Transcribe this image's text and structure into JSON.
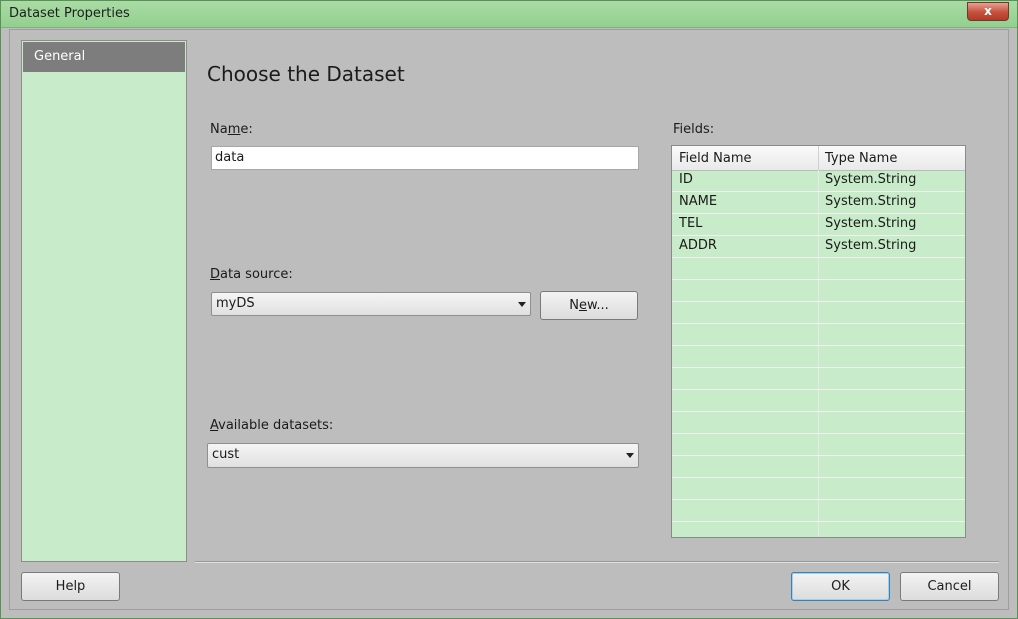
{
  "window": {
    "title": "Dataset Properties",
    "close_label": "x"
  },
  "nav": {
    "items": [
      {
        "label": "General"
      }
    ]
  },
  "main": {
    "heading": "Choose the Dataset",
    "name_label_pre": "Na",
    "name_label_access": "m",
    "name_label_post": "e:",
    "name_value": "data",
    "datasource_label_access": "D",
    "datasource_label_post": "ata source:",
    "datasource_value": "myDS",
    "new_button_pre": "N",
    "new_button_access": "e",
    "new_button_post": "w...",
    "datasets_label_access": "A",
    "datasets_label_post": "vailable datasets:",
    "datasets_value": "cust"
  },
  "fields": {
    "label": "Fields:",
    "columns": [
      "Field Name",
      "Type Name"
    ],
    "rows": [
      [
        "ID",
        "System.String"
      ],
      [
        "NAME",
        "System.String"
      ],
      [
        "TEL",
        "System.String"
      ],
      [
        "ADDR",
        "System.String"
      ],
      [
        "",
        ""
      ],
      [
        "",
        ""
      ],
      [
        "",
        ""
      ],
      [
        "",
        ""
      ],
      [
        "",
        ""
      ],
      [
        "",
        ""
      ],
      [
        "",
        ""
      ],
      [
        "",
        ""
      ],
      [
        "",
        ""
      ],
      [
        "",
        ""
      ],
      [
        "",
        ""
      ],
      [
        "",
        ""
      ],
      [
        "",
        ""
      ]
    ]
  },
  "footer": {
    "help": "Help",
    "ok": "OK",
    "cancel": "Cancel"
  }
}
